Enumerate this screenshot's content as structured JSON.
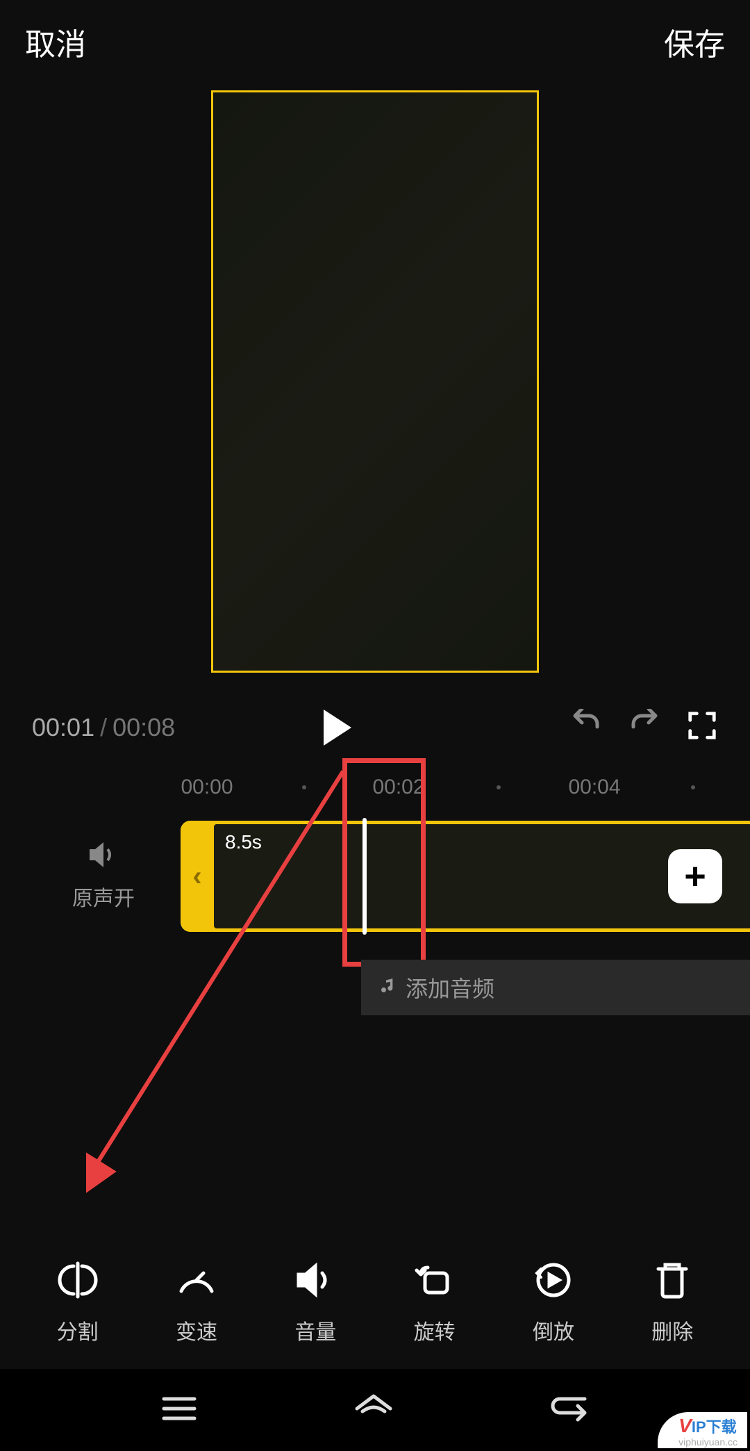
{
  "header": {
    "cancel": "取消",
    "save": "保存"
  },
  "playback": {
    "current_time": "00:01",
    "separator": "/",
    "total_time": "00:08"
  },
  "ruler": {
    "marks": [
      "00:00",
      "00:02",
      "00:04"
    ]
  },
  "clip": {
    "duration": "8.5s",
    "handle_chevron": "‹"
  },
  "sound": {
    "label": "原声开"
  },
  "audio": {
    "add_label": "添加音频"
  },
  "add_clip": {
    "label": "+"
  },
  "tools": {
    "split": "分割",
    "speed": "变速",
    "volume": "音量",
    "rotate": "旋转",
    "reverse": "倒放",
    "delete": "删除"
  },
  "watermark": {
    "text": "IP下载",
    "sub": "viphuiyuan.cc"
  }
}
